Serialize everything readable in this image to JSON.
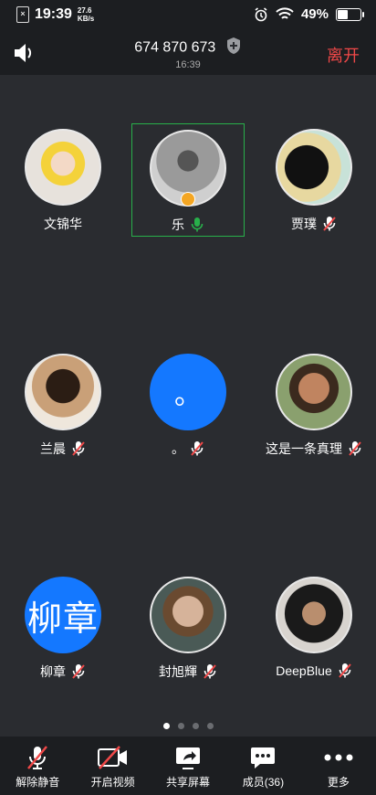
{
  "status": {
    "time": "19:39",
    "speed_value": "27.6",
    "speed_unit": "KB/s",
    "battery": "49%",
    "battery_level": 0.49
  },
  "header": {
    "meeting_id": "674 870 673",
    "elapsed": "16:39",
    "leave_label": "离开"
  },
  "participants": [
    {
      "name": "文锦华",
      "avatar": "photo",
      "mic": "none"
    },
    {
      "name": "乐",
      "avatar": "photo",
      "mic": "on",
      "active": true,
      "host": true
    },
    {
      "name": "贾璞",
      "avatar": "photo",
      "mic": "muted"
    },
    {
      "name": "兰晨",
      "avatar": "photo",
      "mic": "muted"
    },
    {
      "name": "。",
      "avatar": "blue",
      "avatar_text": "。",
      "mic": "muted"
    },
    {
      "name": "这是一条真理",
      "avatar": "photo",
      "mic": "muted"
    },
    {
      "name": "柳章",
      "avatar": "blue",
      "avatar_text": "柳章",
      "mic": "muted"
    },
    {
      "name": "封旭輝",
      "avatar": "photo",
      "mic": "muted"
    },
    {
      "name": "DeepBlue",
      "avatar": "photo",
      "mic": "muted"
    }
  ],
  "pager": {
    "pages": 4,
    "current": 1
  },
  "toolbar": {
    "unmute": "解除静音",
    "video": "开启视频",
    "share": "共享屏幕",
    "members": "成员(36)",
    "more": "更多"
  },
  "colors": {
    "accent_blue": "#1478ff",
    "leave_red": "#f04848",
    "active_green": "#28b04a",
    "host_orange": "#f4a623"
  }
}
